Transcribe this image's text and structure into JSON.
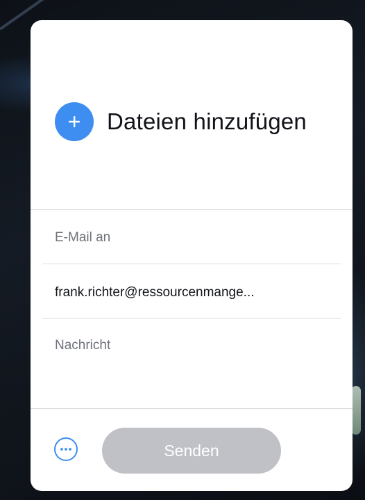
{
  "add_files": {
    "icon": "plus-icon",
    "label": "Dateien hinzufügen"
  },
  "email": {
    "label": "E-Mail an",
    "value": "frank.richter@ressourcenmange..."
  },
  "message": {
    "label": "Nachricht"
  },
  "footer": {
    "more_icon": "more-options-icon",
    "send_label": "Senden"
  },
  "colors": {
    "accent": "#3d8ef0",
    "send_disabled": "#bfc1c6",
    "card": "#ffffff",
    "backdrop": "#0d1117"
  }
}
